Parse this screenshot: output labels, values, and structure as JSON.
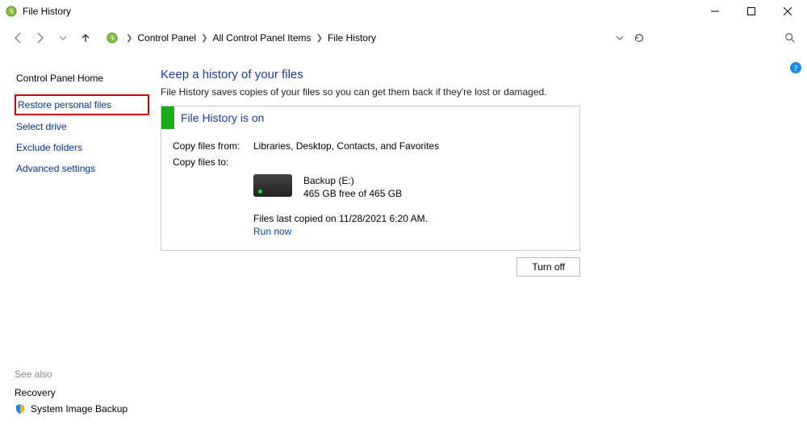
{
  "window": {
    "title": "File History"
  },
  "breadcrumb": {
    "parts": [
      "Control Panel",
      "All Control Panel Items",
      "File History"
    ]
  },
  "sidebar": {
    "home": "Control Panel Home",
    "links": {
      "restore": "Restore personal files",
      "select_drive": "Select drive",
      "exclude": "Exclude folders",
      "advanced": "Advanced settings"
    },
    "see_also_header": "See also",
    "see_also": {
      "recovery": "Recovery",
      "system_image": "System Image Backup"
    }
  },
  "main": {
    "heading": "Keep a history of your files",
    "desc": "File History saves copies of your files so you can get them back if they're lost or damaged.",
    "panel": {
      "status_title": "File History is on",
      "copy_from_label": "Copy files from:",
      "copy_from_value": "Libraries, Desktop, Contacts, and Favorites",
      "copy_to_label": "Copy files to:",
      "drive_name": "Backup (E:)",
      "drive_free": "465 GB free of 465 GB",
      "last_copied": "Files last copied on 11/28/2021 6:20 AM.",
      "run_now": "Run now"
    },
    "turnoff": "Turn off"
  }
}
